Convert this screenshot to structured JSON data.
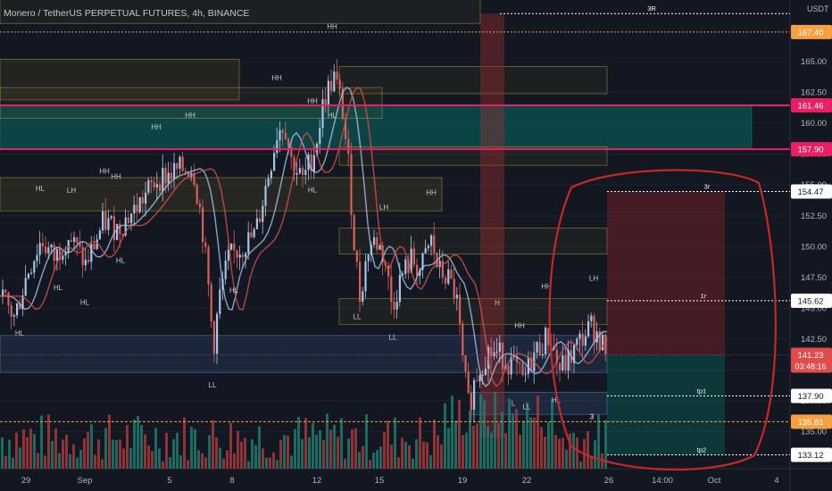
{
  "chart_title": "Monero / TetherUS PERPETUAL FUTURES, 4h, BINANCE",
  "chart_data": {
    "type": "candlestick",
    "symbol": "Monero / TetherUS PERPETUAL FUTURES",
    "interval": "4h",
    "exchange": "BINANCE",
    "currency_label": "USDT",
    "ylim": [
      132.0,
      170.0
    ],
    "y_ticks": [
      135.0,
      137.5,
      140.0,
      142.5,
      145.0,
      147.5,
      150.0,
      152.5,
      155.0,
      157.5,
      160.0,
      162.5,
      165.0
    ],
    "x_ticks": [
      "29",
      "Sep",
      "5",
      "8",
      "12",
      "15",
      "19",
      "22",
      "26",
      "14:00",
      "Oct",
      "4"
    ],
    "current_price": 141.23,
    "countdown": "03:48:16",
    "price_flags": [
      {
        "value": 167.4,
        "color": "#f7a042"
      },
      {
        "value": 161.46,
        "color": "#e91e63"
      },
      {
        "value": 157.9,
        "color": "#e91e63"
      },
      {
        "value": 154.47,
        "color": "#ffffff"
      },
      {
        "value": 145.62,
        "color": "#ffffff"
      },
      {
        "value": 137.9,
        "color": "#ffffff"
      },
      {
        "value": 135.81,
        "color": "#f7a042"
      },
      {
        "value": 133.12,
        "color": "#ffffff"
      }
    ],
    "levels": [
      {
        "name": "3R",
        "value": 168.9
      },
      {
        "name": "3r",
        "value": 154.47
      },
      {
        "name": "1r",
        "value": 145.62
      },
      {
        "name": "tp1",
        "value": 137.9
      },
      {
        "name": "tp2",
        "value": 133.12
      }
    ],
    "position": {
      "entry": 141.23,
      "stop": 154.47,
      "target": 133.12
    },
    "structure_labels": [
      "HH",
      "HL",
      "LH",
      "LL",
      "H",
      "L"
    ],
    "annotation_number": "3",
    "colors": {
      "up": "#a7c4e4",
      "down": "#d9605a",
      "volume_up": "#1e7a6e",
      "volume_down": "#a63a3a",
      "circle": "#c62828"
    }
  }
}
